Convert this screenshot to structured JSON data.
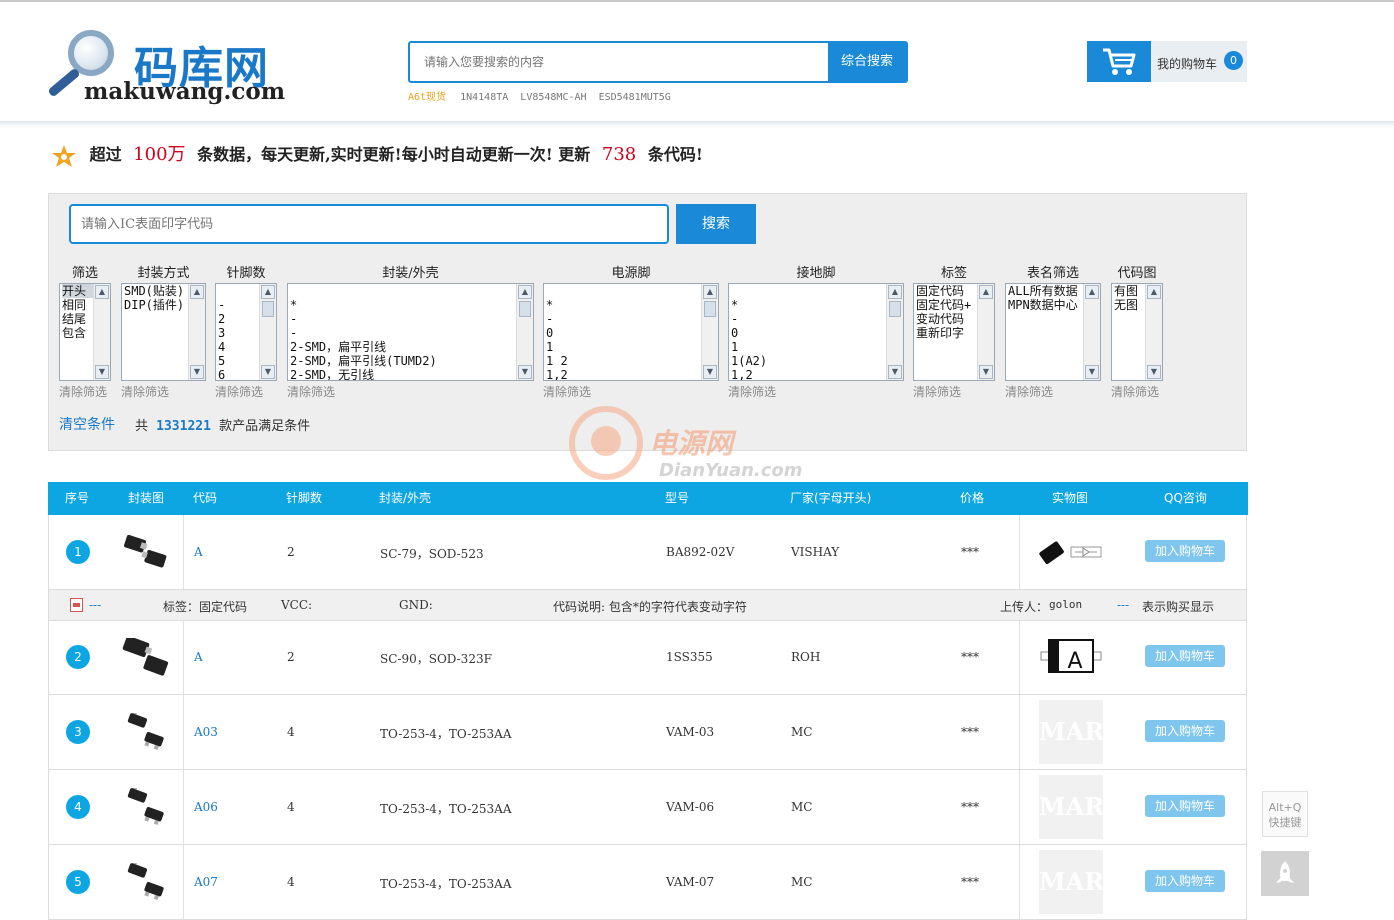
{
  "header": {
    "logo_cn": "码库网",
    "logo_en": "makuwang.com",
    "search_placeholder": "请输入您要搜索的内容",
    "search_button": "综合搜索",
    "hot_label": "A6t现货",
    "hot_items": [
      "1N4148TA",
      "LV8548MC-AH",
      "ESD5481MUT5G"
    ],
    "cart_label": "我的购物车",
    "cart_count": "0"
  },
  "notice": {
    "p1": "超过",
    "count1": "100万",
    "p2": "条数据，每天更新,实时更新!每小时自动更新一次! 更新",
    "count2": "738",
    "p3": "条代码!"
  },
  "filter": {
    "search_placeholder": "请输入IC表面印字代码",
    "search_button": "搜索",
    "clear_label": "清除筛选",
    "clear_all": "清空条件",
    "total_prefix": "共",
    "total_count": "1331221",
    "total_suffix": "款产品满足条件",
    "columns": [
      {
        "label": "筛选",
        "options": [
          "开头",
          "相同",
          "结尾",
          "包含"
        ],
        "selected": 0
      },
      {
        "label": "封装方式",
        "options": [
          "SMD(贴装)",
          "DIP(插件)"
        ]
      },
      {
        "label": "针脚数",
        "options": [
          "",
          "-",
          "2",
          "3",
          "4",
          "5",
          "6"
        ]
      },
      {
        "label": "封装/外壳",
        "options": [
          "",
          "*",
          "-",
          "-",
          "2-SMD，扁平引线",
          "2-SMD，扁平引线(TUMD2)",
          "2-SMD，无引线"
        ]
      },
      {
        "label": "电源脚",
        "options": [
          "",
          "*",
          "-",
          "0",
          "1",
          "1 2",
          "1,2"
        ]
      },
      {
        "label": "接地脚",
        "options": [
          "",
          "*",
          "-",
          "0",
          "1",
          "1(A2)",
          "1,2"
        ]
      },
      {
        "label": "标签",
        "options": [
          "固定代码",
          "固定代码+",
          "变动代码",
          "重新印字"
        ]
      },
      {
        "label": "表名筛选",
        "options": [
          "ALL所有数据",
          "MPN数据中心"
        ]
      },
      {
        "label": "代码图",
        "options": [
          "有图",
          "无图"
        ]
      }
    ]
  },
  "watermark": {
    "cn": "电源网",
    "en": "DianYuan.com"
  },
  "table": {
    "headers": [
      "序号",
      "封装图",
      "代码",
      "针脚数",
      "封装/外壳",
      "型号",
      "厂家(字母开头)",
      "价格",
      "实物图",
      "QQ咨询"
    ],
    "buy_label": "加入购物车",
    "mark_text": "MARK",
    "rows": [
      {
        "no": "1",
        "code": "A",
        "pins": "2",
        "package": "SC-79，SOD-523",
        "model": "BA892-02V",
        "maker": "VISHAY",
        "price": "***"
      },
      {
        "no": "2",
        "code": "A",
        "pins": "2",
        "package": "SC-90，SOD-323F",
        "model": "1SS355",
        "maker": "ROH",
        "price": "***"
      },
      {
        "no": "3",
        "code": "A03",
        "pins": "4",
        "package": "TO-253-4，TO-253AA",
        "model": "VAM-03",
        "maker": "MC",
        "price": "***"
      },
      {
        "no": "4",
        "code": "A06",
        "pins": "4",
        "package": "TO-253-4，TO-253AA",
        "model": "VAM-06",
        "maker": "MC",
        "price": "***"
      },
      {
        "no": "5",
        "code": "A07",
        "pins": "4",
        "package": "TO-253-4，TO-253AA",
        "model": "VAM-07",
        "maker": "MC",
        "price": "***"
      }
    ],
    "detail": {
      "pdf": "---",
      "tag": "标签：固定代码",
      "vcc": "VCC:",
      "gnd": "GND:",
      "desc": "代码说明: 包含*的字符代表变动字符",
      "uploader_label": "上传人：",
      "uploader": "golon",
      "buy_hint_dash": "---",
      "buy_hint": "表示购买显示"
    }
  },
  "side": {
    "shortcut_key": "Alt+Q",
    "shortcut_label": "快捷键"
  },
  "colors": {
    "accent": "#1a8ad8",
    "header_bar": "#0ea6e2",
    "highlight": "#d0021b"
  }
}
